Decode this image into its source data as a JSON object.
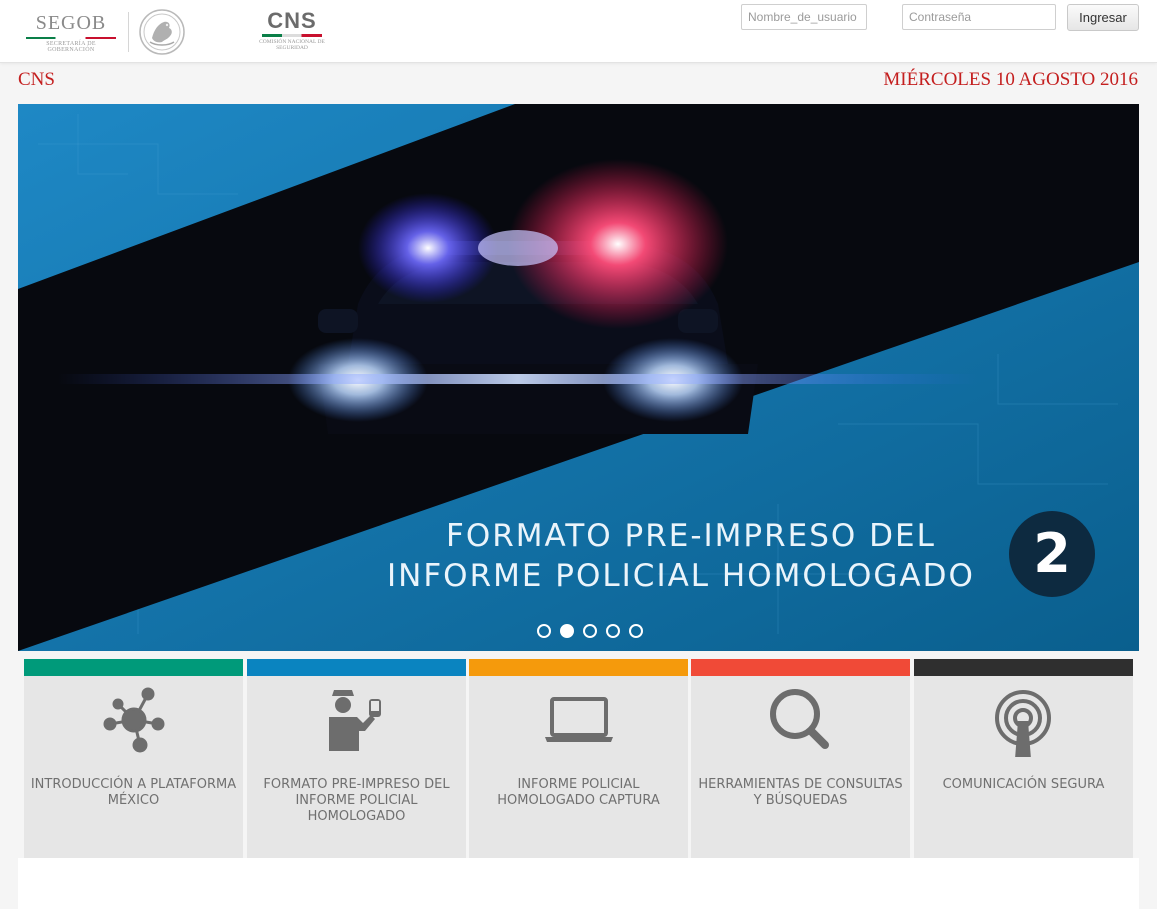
{
  "header": {
    "segob_logo": {
      "title": "SEGOB",
      "subtitle": "SECRETARÍA DE GOBERNACIÓN"
    },
    "cns_logo": {
      "title": "CNS",
      "subtitle": "COMISIÓN NACIONAL DE SEGURIDAD"
    },
    "login": {
      "username_placeholder": "Nombre_de_usuario",
      "username_value": "",
      "password_placeholder": "Contraseña",
      "password_value": "",
      "submit_label": "Ingresar"
    }
  },
  "page": {
    "title": "CNS",
    "date": "MIÉRCOLES 10 AGOSTO 2016"
  },
  "banner": {
    "line1": "FORMATO PRE-IMPRESO DEL",
    "line2": "INFORME POLICIAL HOMOLOGADO",
    "number": "2",
    "slide_count": 5,
    "active_slide": 2
  },
  "tiles": [
    {
      "label": "INTRODUCCIÓN A PLATAFORMA MÉXICO",
      "color": "#009a7a",
      "icon": "network-icon"
    },
    {
      "label": "FORMATO PRE-IMPRESO DEL INFORME POLICIAL HOMOLOGADO",
      "color": "#0a84c0",
      "icon": "police-officer-icon"
    },
    {
      "label": "INFORME POLICIAL HOMOLOGADO CAPTURA",
      "color": "#f59a0c",
      "icon": "laptop-icon"
    },
    {
      "label": "HERRAMIENTAS DE CONSULTAS Y BÚSQUEDAS",
      "color": "#f04a37",
      "icon": "magnifier-icon"
    },
    {
      "label": "COMUNICACIÓN SEGURA",
      "color": "#2f2f2f",
      "icon": "antenna-icon"
    }
  ],
  "colors": {
    "title_red": "#c41f1f",
    "banner_blue": "#0b6fa3",
    "tile_bg": "#e6e6e6",
    "icon_gray": "#6d6d6d"
  }
}
